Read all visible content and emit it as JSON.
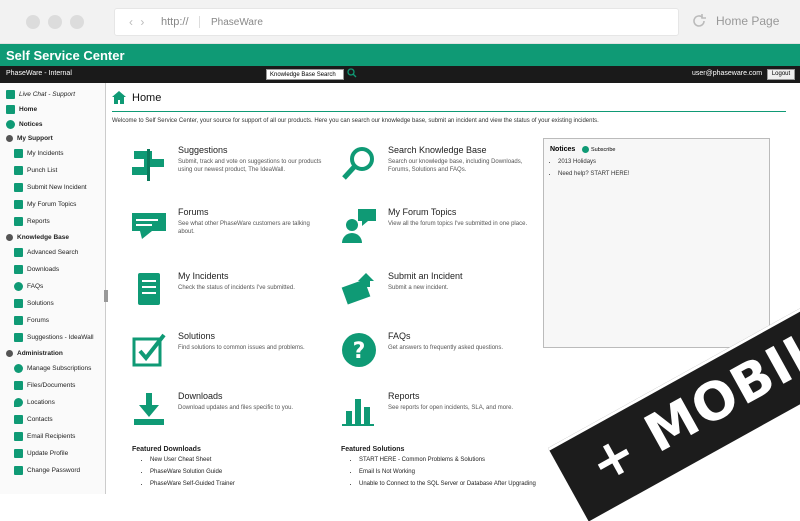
{
  "browser": {
    "protocol": "http://",
    "host": "PhaseWare",
    "home_label": "Home Page"
  },
  "app": {
    "title": "Self Service Center",
    "org": "PhaseWare - Internal",
    "kb_search": "Knowledge Base Search",
    "user": "user@phaseware.com",
    "logout": "Logout"
  },
  "sidebar": {
    "live_chat": "Live Chat - Support",
    "home": "Home",
    "notices": "Notices",
    "my_support": "My Support",
    "my_incidents": "My Incidents",
    "punch_list": "Punch List",
    "submit_incident": "Submit New Incident",
    "my_forum_topics": "My Forum Topics",
    "reports": "Reports",
    "knowledge_base": "Knowledge Base",
    "advanced_search": "Advanced Search",
    "downloads": "Downloads",
    "faqs": "FAQs",
    "solutions": "Solutions",
    "forums": "Forums",
    "suggestions": "Suggestions - IdeaWall",
    "administration": "Administration",
    "manage_subscriptions": "Manage Subscriptions",
    "files_documents": "Files/Documents",
    "locations": "Locations",
    "contacts": "Contacts",
    "email_recipients": "Email Recipients",
    "update_profile": "Update Profile",
    "change_password": "Change Password"
  },
  "main": {
    "title": "Home",
    "welcome": "Welcome to Self Service Center, your source for support of all our products. Here you can search our knowledge base, submit an incident and view the status of your existing incidents.",
    "tiles": {
      "suggestions": {
        "title": "Suggestions",
        "desc": "Submit, track and vote on suggestions to our products using our newest product, The IdeaWall."
      },
      "search_kb": {
        "title": "Search Knowledge Base",
        "desc": "Search our knowledge base, including Downloads, Forums, Solutions and FAQs."
      },
      "forums": {
        "title": "Forums",
        "desc": "See what other PhaseWare customers are talking about."
      },
      "my_forum_topics": {
        "title": "My Forum Topics",
        "desc": "View all the forum topics I've submitted in one place."
      },
      "my_incidents": {
        "title": "My Incidents",
        "desc": "Check the status of incidents I've submitted."
      },
      "submit_incident": {
        "title": "Submit an Incident",
        "desc": "Submit a new incident."
      },
      "solutions": {
        "title": "Solutions",
        "desc": "Find solutions to common issues and problems."
      },
      "faqs": {
        "title": "FAQs",
        "desc": "Get answers to frequently asked questions."
      },
      "downloads": {
        "title": "Downloads",
        "desc": "Download updates and files specific to you."
      },
      "reports": {
        "title": "Reports",
        "desc": "See reports for open incidents, SLA, and more."
      }
    },
    "notices": {
      "title": "Notices",
      "subscribe": "Subscribe",
      "items": [
        "2013 Holidays",
        "Need help? START HERE!"
      ]
    },
    "featured_downloads": {
      "title": "Featured Downloads",
      "items": [
        "New User Cheat Sheet",
        "PhaseWare Solution Guide",
        "PhaseWare Self-Guided Trainer"
      ]
    },
    "featured_solutions": {
      "title": "Featured Solutions",
      "items": [
        "START HERE - Common Problems & Solutions",
        "Email Is Not Working",
        "Unable to Connect to the SQL Server or Database After Upgrading"
      ]
    }
  },
  "banner": {
    "text": "+ MOBILE"
  },
  "colors": {
    "accent": "#0f9a75",
    "topbar": "#1a1a1a"
  }
}
